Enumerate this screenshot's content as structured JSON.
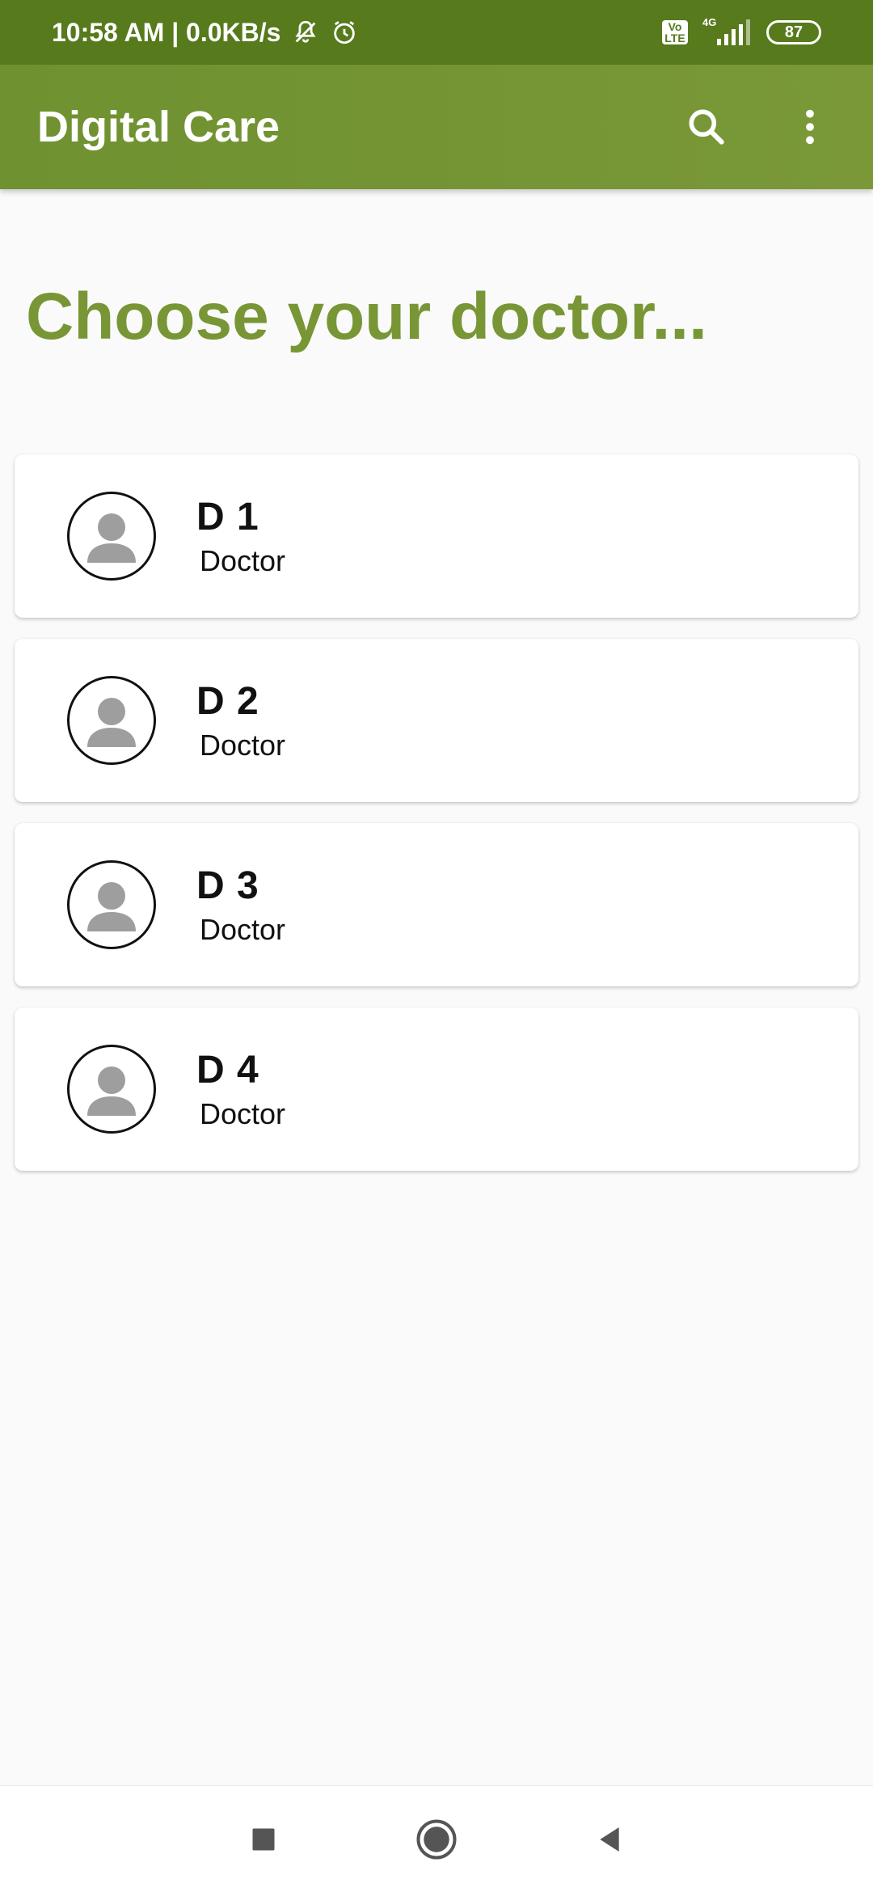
{
  "status_bar": {
    "time_speed": "10:58 AM | 0.0KB/s",
    "volte_top": "Vo",
    "volte_bottom": "LTE",
    "network": "4G",
    "battery": "87",
    "icons": [
      "mute-icon",
      "alarm-icon",
      "volte-icon",
      "signal-icon",
      "battery-icon"
    ]
  },
  "app_bar": {
    "title": "Digital Care",
    "icons": [
      "search-icon",
      "more-vert-icon"
    ]
  },
  "main": {
    "heading": "Choose your doctor...",
    "doctors": [
      {
        "name": "D 1",
        "role": "Doctor"
      },
      {
        "name": "D 2",
        "role": "Doctor"
      },
      {
        "name": "D 3",
        "role": "Doctor"
      },
      {
        "name": "D 4",
        "role": "Doctor"
      }
    ]
  },
  "nav_bar": {
    "icons": [
      "recents-icon",
      "home-icon",
      "back-icon"
    ]
  },
  "colors": {
    "status_bar": "#567a1c",
    "app_bar": "#7a9838",
    "heading": "#789635",
    "background": "#fafafa"
  }
}
